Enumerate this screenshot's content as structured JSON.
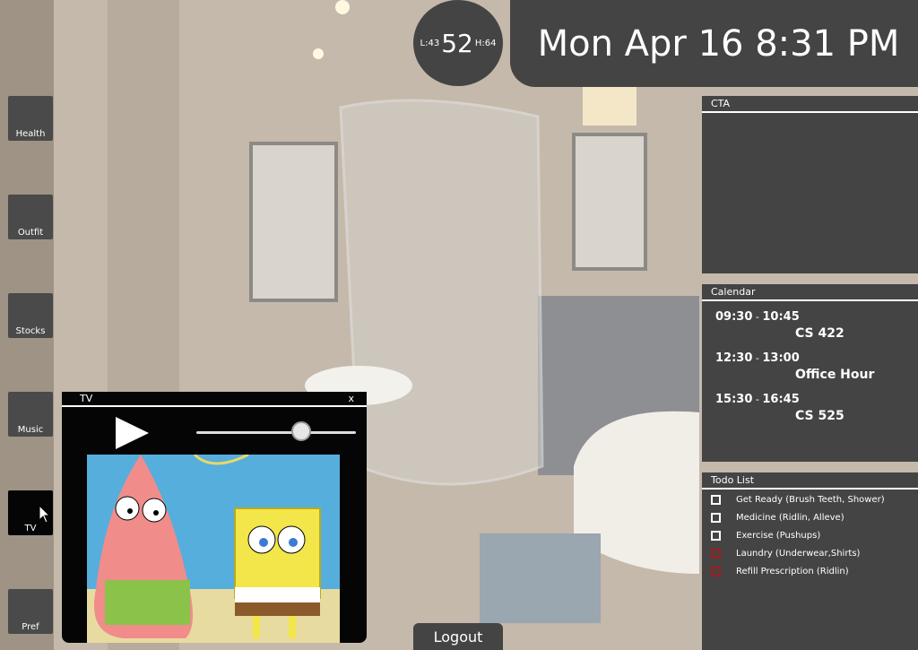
{
  "sidebar": {
    "items": [
      {
        "label": "Health"
      },
      {
        "label": "Outfit"
      },
      {
        "label": "Stocks"
      },
      {
        "label": "Music"
      },
      {
        "label": "TV"
      },
      {
        "label": "Pref"
      }
    ],
    "active": "TV"
  },
  "weather": {
    "low": "L:43",
    "current": "52",
    "high": "H:64"
  },
  "clock": {
    "datetime": "Mon Apr 16 8:31 PM"
  },
  "cta": {
    "title": "CTA"
  },
  "calendar": {
    "title": "Calendar",
    "events": [
      {
        "start": "09:30",
        "end": "10:45",
        "name": "CS 422"
      },
      {
        "start": "12:30",
        "end": "13:00",
        "name": "Office Hour"
      },
      {
        "start": "15:30",
        "end": "16:45",
        "name": "CS 525"
      }
    ]
  },
  "todo": {
    "title": "Todo List",
    "items": [
      {
        "text": "Get Ready (Brush Teeth, Shower)",
        "status": "white"
      },
      {
        "text": "Medicine (Ridlin, Alleve)",
        "status": "white"
      },
      {
        "text": "Exercise (Pushups)",
        "status": "white"
      },
      {
        "text": "Laundry (Underwear,Shirts)",
        "status": "red"
      },
      {
        "text": "Refill Prescription (Ridlin)",
        "status": "red"
      }
    ]
  },
  "tv": {
    "title": "TV",
    "close_label": "x",
    "volume": 0.66
  },
  "logout": {
    "label": "Logout"
  },
  "colors": {
    "panel": "#444444",
    "todo_red": "#a41a1a",
    "active_button": "#050505"
  }
}
